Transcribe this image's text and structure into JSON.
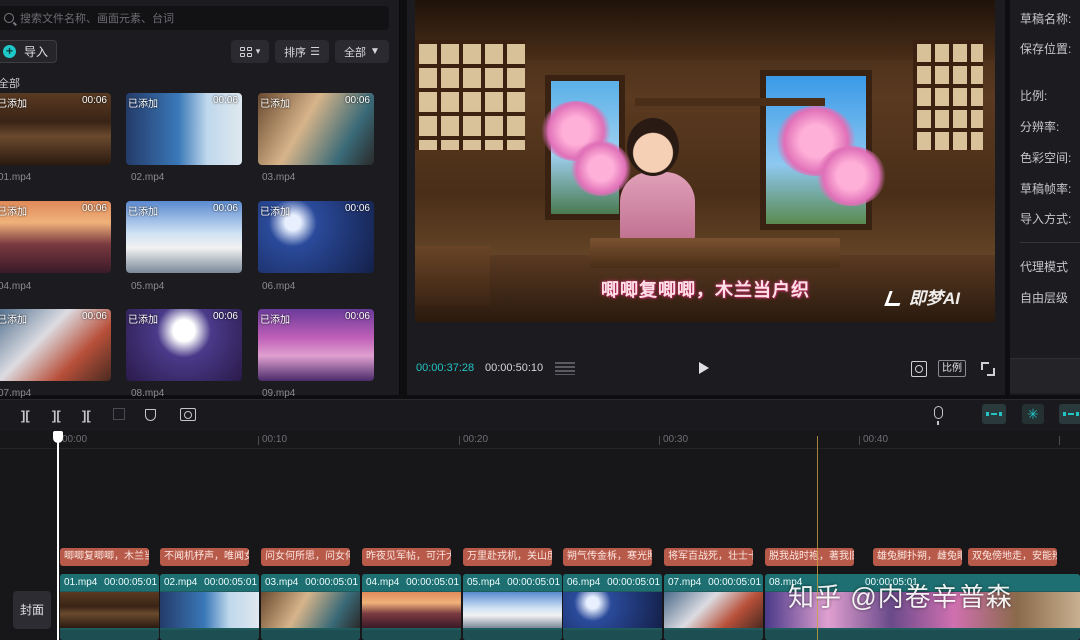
{
  "media": {
    "search_placeholder": "搜索文件名称、画面元素、台词",
    "import_label": "导入",
    "sort_label": "排序",
    "filter_label": "全部",
    "section_label": "全部",
    "clips": [
      {
        "tag": "已添加",
        "duration": "00:06",
        "name": "01.mp4"
      },
      {
        "tag": "已添加",
        "duration": "00:06",
        "name": "02.mp4"
      },
      {
        "tag": "已添加",
        "duration": "00:06",
        "name": "03.mp4"
      },
      {
        "tag": "已添加",
        "duration": "00:06",
        "name": "04.mp4"
      },
      {
        "tag": "已添加",
        "duration": "00:06",
        "name": "05.mp4"
      },
      {
        "tag": "已添加",
        "duration": "00:06",
        "name": "06.mp4"
      },
      {
        "tag": "已添加",
        "duration": "00:06",
        "name": "07.mp4"
      },
      {
        "tag": "已添加",
        "duration": "00:06",
        "name": "08.mp4"
      },
      {
        "tag": "已添加",
        "duration": "00:06",
        "name": "09.mp4"
      }
    ]
  },
  "preview": {
    "subtitle": "唧唧复唧唧，木兰当户织",
    "watermark": "即梦AI",
    "current_time": "00:00:37:28",
    "total_time": "00:00:50:10",
    "ratio_label": "比例"
  },
  "properties": {
    "labels": [
      "草稿名称:",
      "保存位置:",
      "比例:",
      "分辨率:",
      "色彩空间:",
      "草稿帧率:",
      "导入方式:",
      "代理模式",
      "自由层级"
    ]
  },
  "toolbar": {
    "icons": [
      "split-icon",
      "split-left-icon",
      "split-right-icon",
      "delete-icon",
      "shield-icon",
      "screenshot-icon",
      "mic-icon",
      "snap-icon",
      "link-icon",
      "preview-axis-icon"
    ]
  },
  "timeline": {
    "ruler_labels": [
      "00:00",
      "00:10",
      "00:20",
      "00:30",
      "00:40"
    ],
    "cover_label": "封面",
    "text_clips": [
      "唧唧复唧唧，木兰当户织",
      "不闻机杼声，唯闻女叹息",
      "问女何所思，问女何所忆",
      "昨夜见军帖，可汗大点兵",
      "万里赴戎机，关山度若飞",
      "朔气传金柝，寒光照铁衣",
      "将军百战死，壮士十年归",
      "脱我战时袍，著我旧时裳",
      "雄兔脚扑朔，雌兔眼迷离",
      "双兔傍地走，安能辨我是雄雌"
    ],
    "video_clips": [
      {
        "name": "01.mp4",
        "duration": "00:00:05:01"
      },
      {
        "name": "02.mp4",
        "duration": "00:00:05:01"
      },
      {
        "name": "03.mp4",
        "duration": "00:00:05:01"
      },
      {
        "name": "04.mp4",
        "duration": "00:00:05:01"
      },
      {
        "name": "05.mp4",
        "duration": "00:00:05:01"
      },
      {
        "name": "06.mp4",
        "duration": "00:00:05:01"
      },
      {
        "name": "07.mp4",
        "duration": "00:00:05:01"
      },
      {
        "name": "08.mp4",
        "duration": "00:00:05:01"
      }
    ]
  },
  "overlay": {
    "zhihu_watermark": "知乎 @内卷辛普森"
  }
}
